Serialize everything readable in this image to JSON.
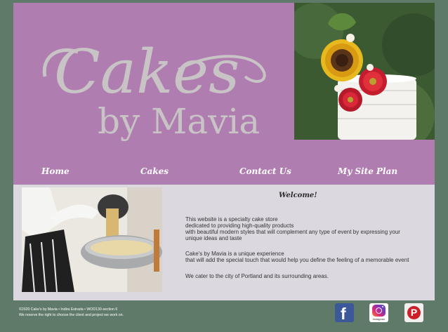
{
  "header": {
    "logo": {
      "script_text": "Cakes",
      "by_text": "by Mavia"
    }
  },
  "nav": {
    "items": [
      {
        "label": "Home"
      },
      {
        "label": "Cakes"
      },
      {
        "label": "Contact Us"
      },
      {
        "label": "My Site Plan"
      }
    ]
  },
  "main": {
    "welcome": "Welcome!",
    "paragraph1": [
      "This website is a specialty cake store",
      "dedicated to providing high-quality products",
      "with beautiful modern styles that will complement any type of event by expressing your unique ideas and taste"
    ],
    "paragraph2": [
      "Cake's by Mavia is a unique experience",
      "that will add the special touch that would help you define the feeling of a memorable event"
    ],
    "paragraph3": "We cater to the city of Portland and its surrounding areas."
  },
  "footer": {
    "copyright": "©2020 Cake's by Mavia • Indira Estrada • WOD130-section 6",
    "rights": "We reserve the right to choose the client and project we work on."
  },
  "social": {
    "facebook_icon": "f",
    "instagram_label": "Instagram",
    "pinterest_icon": "P"
  },
  "colors": {
    "background": "#5f7a68",
    "header": "#b07db0",
    "content": "#dcd8e0",
    "logo_text": "#c8c4c6",
    "facebook": "#3b5998",
    "pinterest": "#cb2027"
  }
}
